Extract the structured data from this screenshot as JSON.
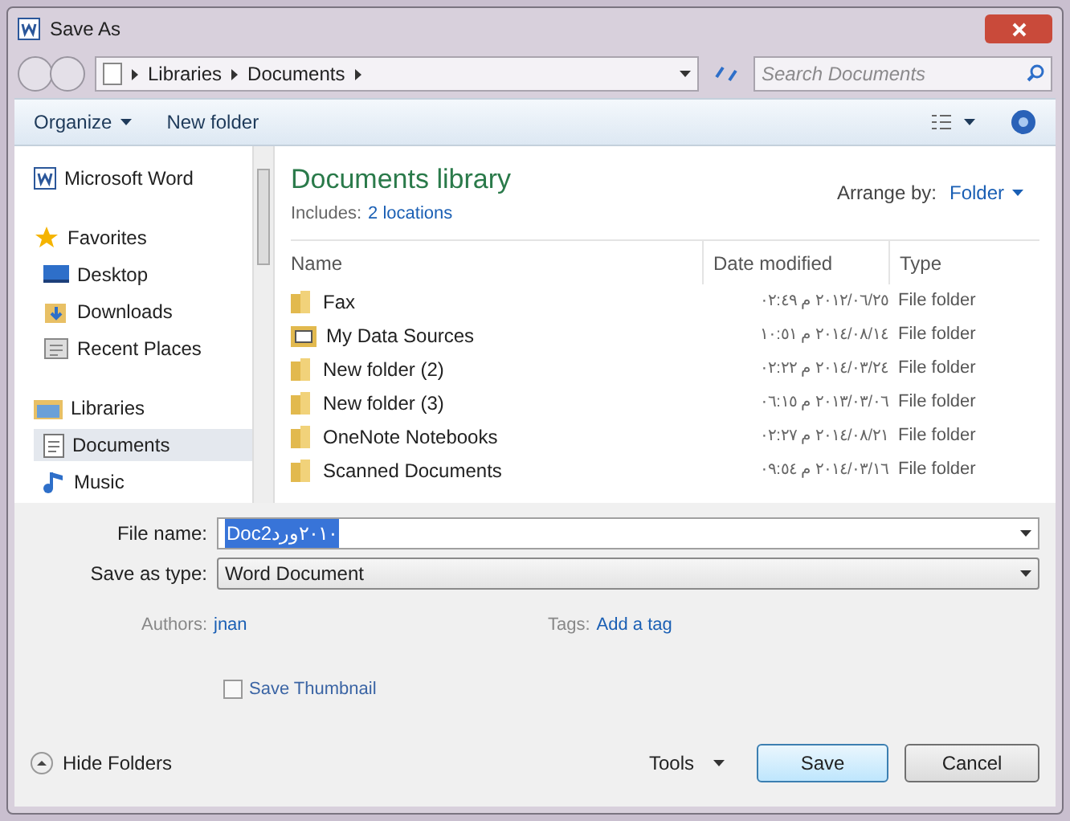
{
  "window": {
    "title": "Save As"
  },
  "address": {
    "crumbs": [
      "Libraries",
      "Documents"
    ],
    "search_placeholder": "Search Documents"
  },
  "toolbar": {
    "organize": "Organize",
    "new_folder": "New folder"
  },
  "nav": [
    {
      "label": "Microsoft Word",
      "kind": "app",
      "selected": false
    },
    {
      "label": "Favorites",
      "kind": "star",
      "selected": false
    },
    {
      "label": "Desktop",
      "kind": "desktop",
      "selected": false
    },
    {
      "label": "Downloads",
      "kind": "download",
      "selected": false
    },
    {
      "label": "Recent Places",
      "kind": "recent",
      "selected": false
    },
    {
      "label": "Libraries",
      "kind": "library",
      "selected": false
    },
    {
      "label": "Documents",
      "kind": "doc",
      "selected": true
    },
    {
      "label": "Music",
      "kind": "music",
      "selected": false
    }
  ],
  "library": {
    "title": "Documents library",
    "includes_label": "Includes:",
    "includes_link": "2 locations",
    "arrange_label": "Arrange by:",
    "arrange_value": "Folder"
  },
  "table": {
    "columns": [
      "Name",
      "Date modified",
      "Type"
    ],
    "rows": [
      {
        "name": "Fax",
        "kind": "folder",
        "date": "٢٠١٢/٠٦/٢٥ م ٠٢:٤٩",
        "type": "File folder"
      },
      {
        "name": "My Data Sources",
        "kind": "datasource",
        "date": "٢٠١٤/٠٨/١٤ م ١٠:٥١",
        "type": "File folder"
      },
      {
        "name": "New folder (2)",
        "kind": "folder",
        "date": "٢٠١٤/٠٣/٢٤ م ٠٢:٢٢",
        "type": "File folder"
      },
      {
        "name": "New folder (3)",
        "kind": "folder",
        "date": "٢٠١٣/٠٣/٠٦ م ٠٦:١٥",
        "type": "File folder"
      },
      {
        "name": "OneNote Notebooks",
        "kind": "folder",
        "date": "٢٠١٤/٠٨/٢١ م ٠٢:٢٧",
        "type": "File folder"
      },
      {
        "name": "Scanned Documents",
        "kind": "folder",
        "date": "٢٠١٤/٠٣/١٦ م ٠٩:٥٤",
        "type": "File folder"
      }
    ]
  },
  "form": {
    "file_name_label": "File name:",
    "file_name": "Doc٢٠١٠ورد2",
    "type_label": "Save as type:",
    "type_value": "Word Document",
    "authors_label": "Authors:",
    "authors_value": "jnan",
    "tags_label": "Tags:",
    "tags_value": "Add a tag",
    "thumbnail_label": "Save Thumbnail",
    "thumbnail_checked": false
  },
  "footer": {
    "hide_folders": "Hide Folders",
    "tools": "Tools",
    "save": "Save",
    "cancel": "Cancel"
  }
}
